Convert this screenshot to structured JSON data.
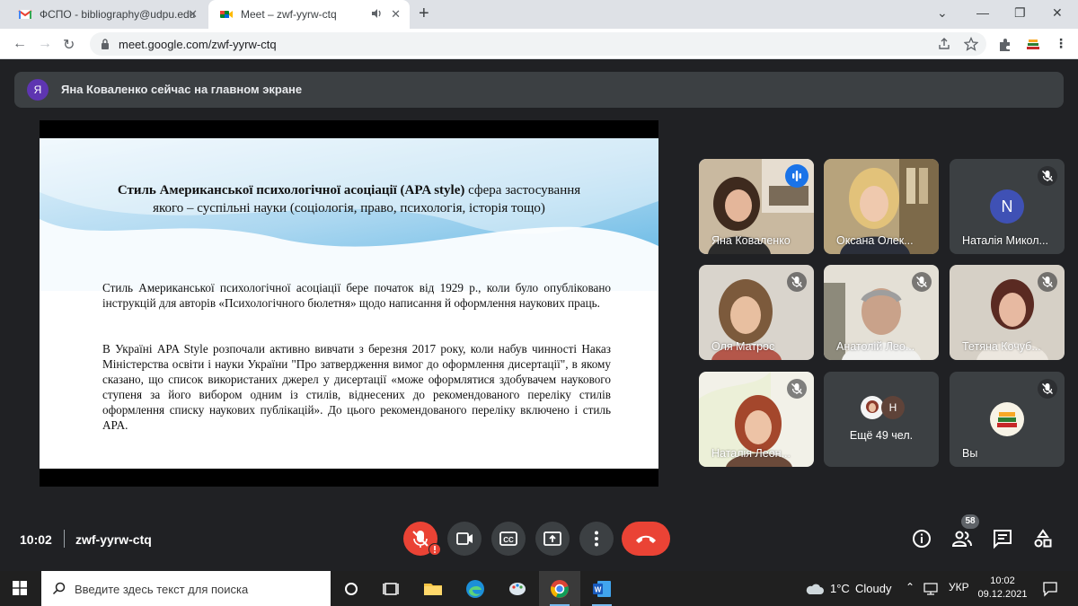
{
  "browser": {
    "tabs": [
      {
        "title": "ФСПО - bibliography@udpu.edu",
        "icon": "gmail-icon",
        "active": false
      },
      {
        "title": "Meet – zwf-yyrw-ctq",
        "icon": "google-meet-icon",
        "active": true
      }
    ],
    "url": "meet.google.com/zwf-yyrw-ctq"
  },
  "meet": {
    "presenter_avatar_letter": "Я",
    "presenter_notice": "Яна Коваленко сейчас на главном экране",
    "slide": {
      "title_bold": "Стиль Американської психологічної асоціації (APA style)",
      "title_rest": " сфера застосування якого – суспільні науки (соціологія, право, психологія, історія тощо)",
      "paragraph_1": "Стиль Американської психологічної асоціації бере початок від 1929 р., коли було опубліковано інструкцій для авторів «Психологічного бюлетня» щодо написання й оформлення наукових праць.",
      "paragraph_2": "В Україні APA Style розпочали активно вивчати з березня 2017 року, коли набув чинності Наказ Міністерства освіти і науки України \"Про затвердження вимог до оформлення дисертації\", в якому сказано, що список використаних джерел у дисертації «може оформлятися здобувачем наукового ступеня за його вибором одним із стилів, віднесених до рекомендованого переліку стилів оформлення списку наукових публікацій». До цього рекомендованого переліку включено і стиль APA."
    },
    "participants": [
      {
        "name": "Яна Коваленко",
        "muted": false,
        "speaking": true,
        "kind": "video"
      },
      {
        "name": "Оксана Олек...",
        "muted": false,
        "speaking": false,
        "kind": "video"
      },
      {
        "name": "Наталія Микол...",
        "muted": true,
        "speaking": false,
        "kind": "letter",
        "letter": "N"
      },
      {
        "name": "Оля Матрос",
        "muted": true,
        "speaking": false,
        "kind": "video"
      },
      {
        "name": "Анатолій Лео...",
        "muted": true,
        "speaking": false,
        "kind": "video"
      },
      {
        "name": "Тетяна Кочуб...",
        "muted": true,
        "speaking": false,
        "kind": "video"
      },
      {
        "name": "Наталія Леон...",
        "muted": true,
        "speaking": false,
        "kind": "video"
      },
      {
        "name": "Ещё 49 чел.",
        "kind": "more",
        "letter": "Н"
      },
      {
        "name": "Вы",
        "muted": true,
        "kind": "self"
      }
    ],
    "controls": {
      "time": "10:02",
      "meeting_code": "zwf-yyrw-ctq",
      "participant_count": "58"
    }
  },
  "taskbar": {
    "search_placeholder": "Введите здесь текст для поиска",
    "weather_temp": "1°C",
    "weather_text": "Cloudy",
    "language": "УКР",
    "time": "10:02",
    "date": "09.12.2021"
  },
  "colors": {
    "meet_bg": "#202124",
    "tile_bg": "#3c4043",
    "red": "#ea4335",
    "speaking_blue": "#1a73e8",
    "letter_avatar": "#3f51b5"
  }
}
